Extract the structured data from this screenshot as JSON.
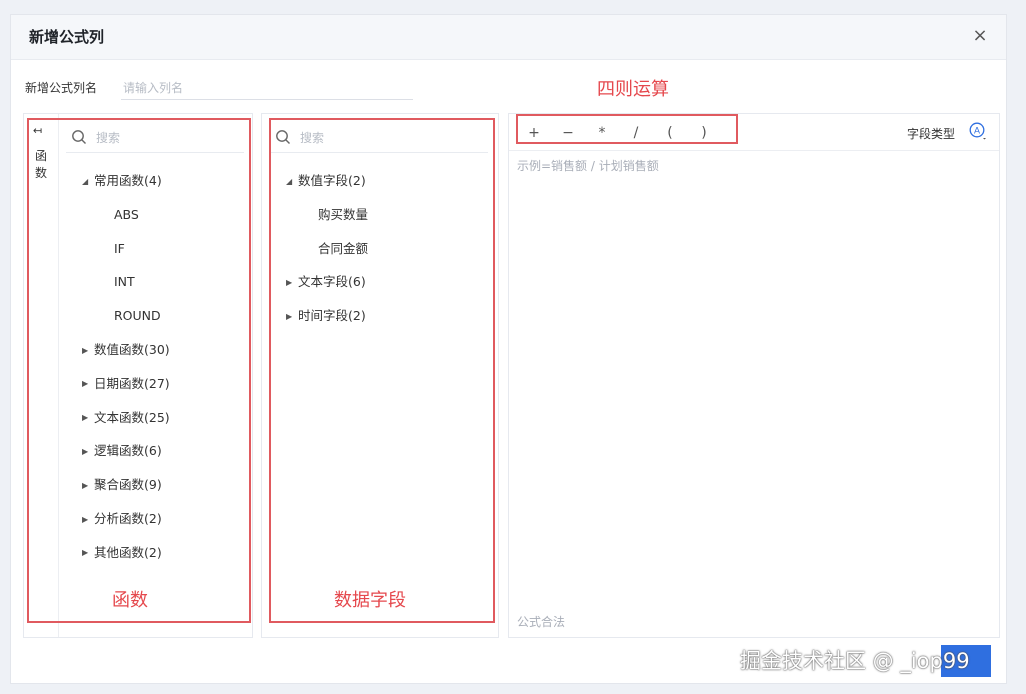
{
  "dialog": {
    "title": "新增公式列",
    "close_icon": "close-icon ×"
  },
  "name_row": {
    "label": "新增公式列名",
    "placeholder": "请输入列名"
  },
  "annotations": {
    "four_ops": "四则运算",
    "functions": "函数",
    "data_fields": "数据字段",
    "color": "#e05a5f"
  },
  "left_panel": {
    "collapse_icon": "↤",
    "vertical_label": "函数",
    "search_placeholder": "搜索",
    "tree": [
      {
        "label": "常用函数(4)",
        "expanded": true,
        "children": [
          "ABS",
          "IF",
          "INT",
          "ROUND"
        ]
      },
      {
        "label": "数值函数(30)",
        "expanded": false
      },
      {
        "label": "日期函数(27)",
        "expanded": false
      },
      {
        "label": "文本函数(25)",
        "expanded": false
      },
      {
        "label": "逻辑函数(6)",
        "expanded": false
      },
      {
        "label": "聚合函数(9)",
        "expanded": false
      },
      {
        "label": "分析函数(2)",
        "expanded": false
      },
      {
        "label": "其他函数(2)",
        "expanded": false
      }
    ]
  },
  "mid_panel": {
    "search_placeholder": "搜索",
    "tree": [
      {
        "label": "数值字段(2)",
        "expanded": true,
        "children": [
          "购买数量",
          "合同金额"
        ]
      },
      {
        "label": "文本字段(6)",
        "expanded": false
      },
      {
        "label": "时间字段(2)",
        "expanded": false
      }
    ]
  },
  "right_panel": {
    "operators": [
      "+",
      "−",
      "*",
      "/",
      "(",
      ")"
    ],
    "field_type_label": "字段类型",
    "editor_placeholder": "示例=销售额 / 计划销售额",
    "syntax_status": "公式合法"
  },
  "watermark": "掘金技术社区 @ _iop99",
  "colors": {
    "accent": "#2f6fe0",
    "border": "#e6e9ef",
    "placeholder": "#b7bcc5"
  }
}
